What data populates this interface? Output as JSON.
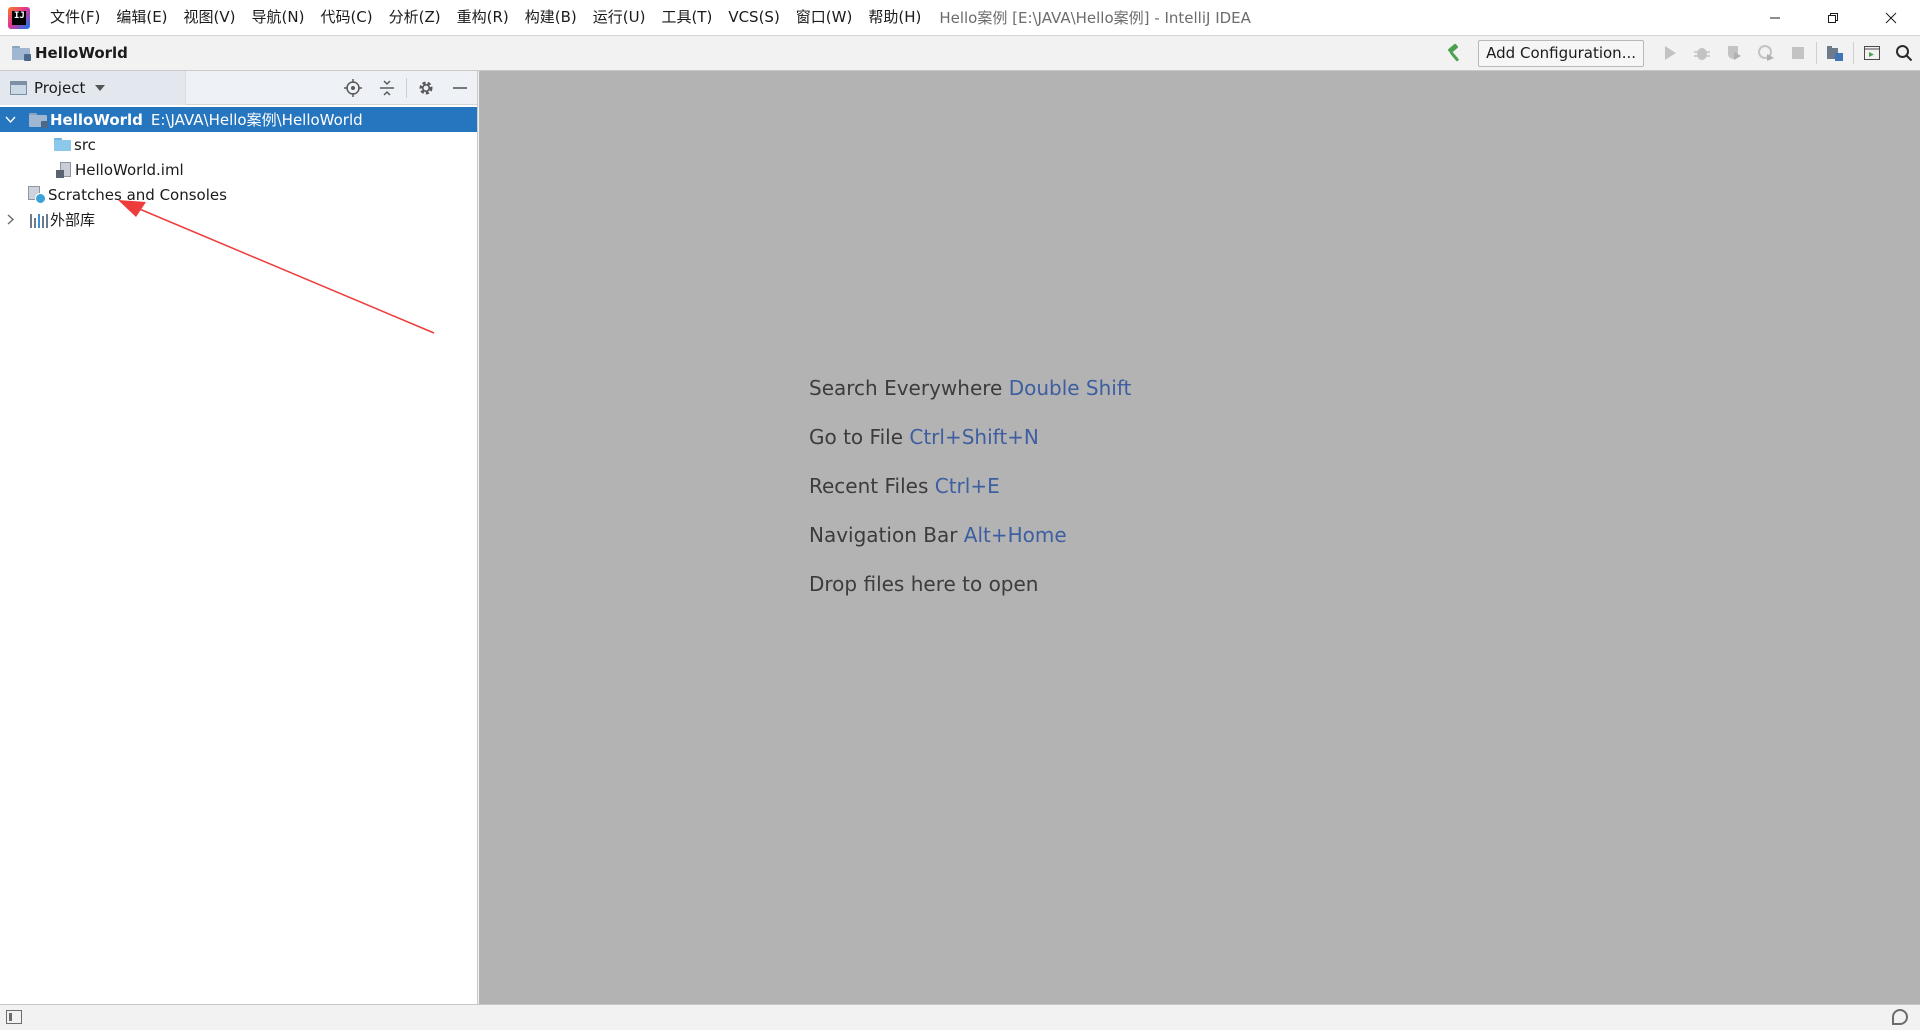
{
  "titlebar": {
    "app_icon": "intellij-idea-logo",
    "app_icon_text": "IJ",
    "menu": [
      "文件(F)",
      "编辑(E)",
      "视图(V)",
      "导航(N)",
      "代码(C)",
      "分析(Z)",
      "重构(R)",
      "构建(B)",
      "运行(U)",
      "工具(T)",
      "VCS(S)",
      "窗口(W)",
      "帮助(H)"
    ],
    "window_title": "Hello案例 [E:\\JAVA\\Hello案例] - IntelliJ IDEA"
  },
  "navbar": {
    "breadcrumb": "HelloWorld",
    "add_configuration": "Add Configuration..."
  },
  "project_panel": {
    "title": "Project",
    "tree": {
      "root_name": "HelloWorld",
      "root_path": "E:\\JAVA\\Hello案例\\HelloWorld",
      "src": "src",
      "iml": "HelloWorld.iml",
      "scratches": "Scratches and Consoles",
      "external_libs": "外部库"
    }
  },
  "editor": {
    "hints": [
      {
        "text": "Search Everywhere",
        "key": "Double Shift"
      },
      {
        "text": "Go to File",
        "key": "Ctrl+Shift+N"
      },
      {
        "text": "Recent Files",
        "key": "Ctrl+E"
      },
      {
        "text": "Navigation Bar",
        "key": "Alt+Home"
      },
      {
        "text": "Drop files here to open",
        "key": ""
      }
    ]
  },
  "colors": {
    "selection": "#2675bf",
    "editor_bg": "#b3b3b3",
    "shortcut": "#3d5ea0",
    "annotation_arrow": "#ee3b3b",
    "build_hammer": "#4ca04f"
  }
}
